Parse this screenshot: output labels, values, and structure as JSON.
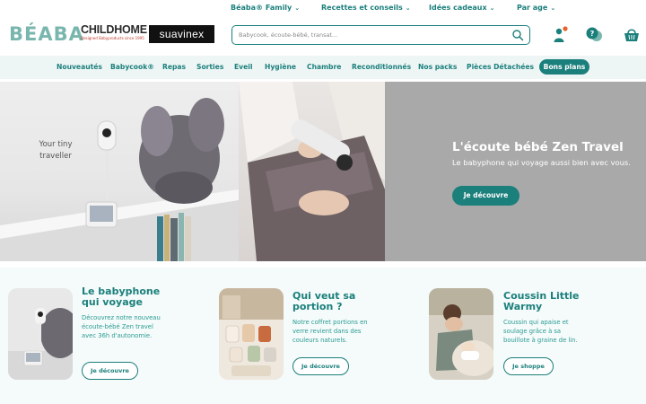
{
  "topnav": {
    "items": [
      {
        "label": "Béaba® Family"
      },
      {
        "label": "Recettes et conseils"
      },
      {
        "label": "Idées cadeaux"
      },
      {
        "label": "Par age"
      }
    ],
    "chevron": "⌄"
  },
  "header": {
    "logos": {
      "beaba": "BÉABA",
      "childhome": "CHILDHOME",
      "childhome_tag": "Designed Babyproducts since 1995",
      "suavinex": "suavinex"
    },
    "search": {
      "placeholder": "Babycook, écoute-bébé, transat..."
    },
    "icons": [
      "user-icon",
      "help-chat-icon",
      "cart-icon"
    ],
    "notification_color": "#e8622c"
  },
  "catnav": {
    "items": [
      "Nouveautés",
      "Babycook®",
      "Repas",
      "Sorties",
      "Eveil",
      "Hygiène",
      "Chambre",
      "Reconditionnés",
      "Nos packs",
      "Pièces Détachées"
    ],
    "highlight": "Bons plans"
  },
  "hero": {
    "caption": "Your tiny traveller",
    "title": "L'écoute bébé Zen Travel",
    "subtitle": "Le babyphone qui voyage aussi bien avec vous.",
    "cta": "Je découvre"
  },
  "promos": [
    {
      "title": "Le babyphone qui voyage",
      "text": "Découvrez notre nouveau écoute-bébé Zen travel avec 36h d'autonomie.",
      "cta": "Je découvre"
    },
    {
      "title": "Qui veut sa portion ?",
      "text": "Notre coffret portions en verre revient dans des couleurs naturels.",
      "cta": "Je découvre"
    },
    {
      "title": "Coussin Little Warmy",
      "text": "Coussin qui apaise et soulage grâce à sa bouillote à graine de lin.",
      "cta": "Je shoppe"
    }
  ],
  "colors": {
    "accent": "#1b7f7c",
    "light_bg": "#eef6f5",
    "hero_bg": "#a9a9a9"
  }
}
